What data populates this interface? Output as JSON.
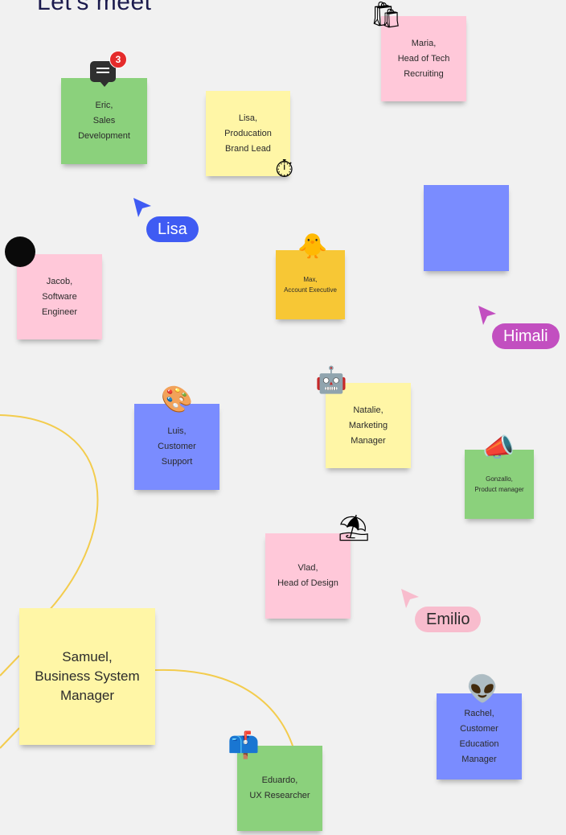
{
  "board": {
    "title": "Let's meet"
  },
  "colors": {
    "pink": "#ffc8d9",
    "green": "#8bd17c",
    "yellow": "#fff6a6",
    "blue": "#7a8cff",
    "gold": "#f7c735",
    "connector": "#f3cc4d"
  },
  "notes": {
    "maria": "Maria,\nHead of Tech\nRecruiting",
    "eric": "Eric,\nSales\nDevelopment",
    "lisa": "Lisa,\nProducation\nBrand Lead",
    "jacob": "Jacob,\nSoftware\nEngineer",
    "max": "Max,\nAccount Executive",
    "natalie": "Natalie,\nMarketing\nManager",
    "luis": "Luis,\nCustomer\nSupport",
    "gonzalo": "Gonzallo,\nProduct manager",
    "vlad": "Vlad,\nHead of Design",
    "samuel": "Samuel,\nBusiness System\nManager",
    "rachel": "Rachel,\nCustomer\nEducation\nManager",
    "eduardo": "Eduardo,\nUX Researcher",
    "blank": ""
  },
  "cursors": {
    "lisa": {
      "name": "Lisa",
      "color": "#3f5bf3"
    },
    "himali": {
      "name": "Himali",
      "color": "#c24fc0"
    },
    "emilio": {
      "name": "Emilio",
      "color": "#f8bccd"
    }
  },
  "comment_badge": {
    "count": "3"
  },
  "stickers": {
    "shopping_bags": "🛍",
    "stopwatch": "⏱",
    "duck": "🐥",
    "robot": "🤖",
    "palette": "🎨",
    "megaphone": "📣",
    "umbrella": "⛱",
    "alien": "👽",
    "mailbox": "📫"
  }
}
